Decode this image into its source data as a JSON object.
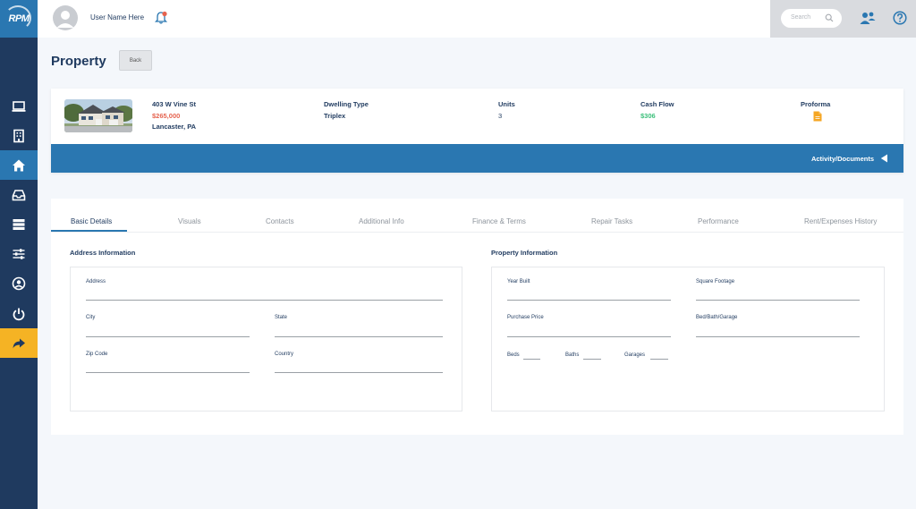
{
  "app": {
    "logo_text": "RPM"
  },
  "user": {
    "name": "User Name Here"
  },
  "search": {
    "placeholder": "Search"
  },
  "page": {
    "title": "Property",
    "back_label": "Back"
  },
  "property": {
    "address_line": "403 W Vine St",
    "price": "$265,000",
    "city_state": "Lancaster, PA",
    "dwelling_type_label": "Dwelling Type",
    "dwelling_type_value": "Triplex",
    "units_label": "Units",
    "units_value": "3",
    "cash_flow_label": "Cash Flow",
    "cash_flow_value": "$306",
    "proforma_label": "Proforma",
    "activity_label": "Activity/Documents"
  },
  "tabs": [
    {
      "label": "Basic Details"
    },
    {
      "label": "Visuals"
    },
    {
      "label": "Contacts"
    },
    {
      "label": "Additional Info"
    },
    {
      "label": "Finance & Terms"
    },
    {
      "label": "Repair Tasks"
    },
    {
      "label": "Performance"
    },
    {
      "label": "Rent/Expenses History"
    }
  ],
  "address_section": {
    "title": "Address Information",
    "address": "Address",
    "city": "City",
    "state": "State",
    "zip": "Zip Code",
    "country": "Country"
  },
  "property_section": {
    "title": "Property Information",
    "year_built": "Year Built",
    "square_footage": "Square Footage",
    "purchase_price": "Purchase Price",
    "bed_bath_garage": "Bed/Bath/Garage",
    "beds": "Beds",
    "baths": "Baths",
    "garages": "Garages"
  },
  "colors": {
    "navy": "#1f3a5f",
    "blue": "#2a77b1",
    "yellow": "#f5b324",
    "price_red": "#e5634f",
    "cash_green": "#3bbf7a",
    "proforma_orange": "#f5a623"
  },
  "icons": {
    "nav": [
      "laptop-icon",
      "building-icon",
      "home-icon",
      "inbox-icon",
      "server-icon",
      "sliders-icon",
      "user-circle-icon",
      "power-icon",
      "share-icon"
    ],
    "top": [
      "avatar",
      "bell-icon",
      "search-icon",
      "users-icon",
      "help-icon"
    ]
  }
}
